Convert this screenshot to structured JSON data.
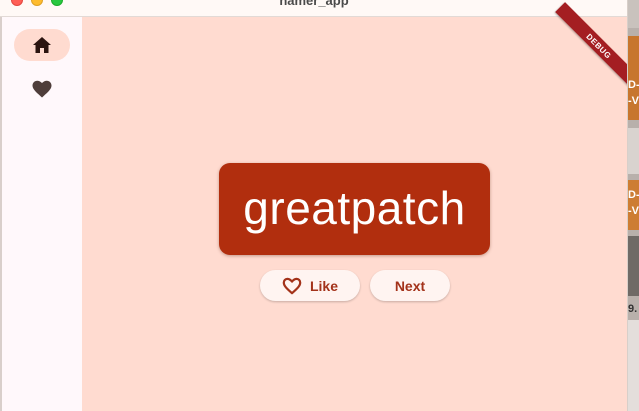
{
  "window": {
    "title": "namer_app"
  },
  "nav_rail": {
    "items": [
      {
        "name": "home",
        "icon": "home-icon",
        "selected": true
      },
      {
        "name": "favorites",
        "icon": "heart-icon",
        "selected": false
      }
    ]
  },
  "main": {
    "word_pair": "greatpatch",
    "buttons": {
      "like_label": "Like",
      "next_label": "Next"
    }
  },
  "debug_banner": {
    "label": "DEBUG"
  },
  "backdrop": {
    "fragments": [
      "D-",
      "-V",
      "D-",
      "-V",
      "9."
    ]
  },
  "colors": {
    "page_background": "#ffdbd0",
    "card": "#b12e0e",
    "card_text": "#ffffff",
    "button_background": "#fff4f1",
    "button_text": "#a3321a",
    "rail_background": "#fff8fb",
    "rail_selected": "#ffdbd0",
    "debug_banner": "#a41e22"
  }
}
